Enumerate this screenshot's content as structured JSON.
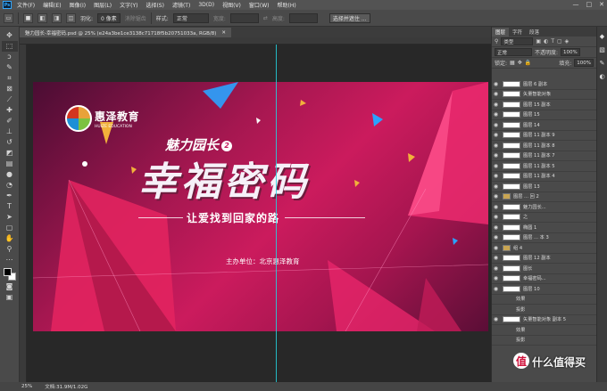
{
  "menubar": {
    "logo": "Ps",
    "items": [
      "文件(F)",
      "编辑(E)",
      "图像(I)",
      "图层(L)",
      "文字(Y)",
      "选择(S)",
      "滤镜(T)",
      "3D(D)",
      "视图(V)",
      "窗口(W)",
      "帮助(H)"
    ],
    "window_controls": [
      "—",
      "□",
      "✕"
    ]
  },
  "options": {
    "feather_label": "羽化:",
    "feather_value": "0 像素",
    "antialias_label": "消除锯齿",
    "style_label": "样式:",
    "style_value": "正常",
    "width_label": "宽度:",
    "height_label": "高度:",
    "mask_button": "选择并遮住 ..."
  },
  "document": {
    "tab_title": "魅力园长-幸福密码.psd @ 25% (e24a3be1ce3138c71718f5b20751033a, RGB/8)",
    "close": "✕"
  },
  "artwork": {
    "logo_cn": "惠泽教育",
    "logo_en": "HUIZE EDUCATION",
    "subtitle": "魅力园长",
    "badge": "2",
    "title": "幸福密码",
    "tagline": "让爱找到回家的路",
    "organizer": "主办单位：北京惠泽教育"
  },
  "panels": {
    "tabs": [
      "图层",
      "字符",
      "段落"
    ],
    "filter_kind": "类型",
    "blend_mode": "正常",
    "opacity_label": "不透明度:",
    "opacity_value": "100%",
    "lock_label": "锁定:",
    "fill_label": "填充:",
    "fill_value": "100%",
    "layers": [
      {
        "name": "图层 6 副本"
      },
      {
        "name": "矢量智能对象"
      },
      {
        "name": "图层 15 副本"
      },
      {
        "name": "图层 15"
      },
      {
        "name": "图层 14"
      },
      {
        "name": "图层 11 副本 9"
      },
      {
        "name": "图层 11 副本 8"
      },
      {
        "name": "图层 11 副本 7"
      },
      {
        "name": "图层 11 副本 5"
      },
      {
        "name": "图层 11 副本 4"
      },
      {
        "name": "图层 13"
      },
      {
        "name": "图层 ... 回 2"
      },
      {
        "name": "魅力园长..."
      },
      {
        "name": "之"
      },
      {
        "name": "椭圆 1"
      },
      {
        "name": "图层 ... 本 3"
      },
      {
        "name": "组 4"
      },
      {
        "name": "图层 12 副本"
      },
      {
        "name": "图长"
      },
      {
        "name": "幸福密码..."
      },
      {
        "name": "图层 10"
      },
      {
        "name": "效果"
      },
      {
        "name": "投影"
      },
      {
        "name": "矢量智能对象 副本 5"
      },
      {
        "name": "效果"
      },
      {
        "name": "投影"
      }
    ]
  },
  "status": {
    "zoom": "25%",
    "doc_size": "文档:31.9M/1.02G"
  },
  "watermark": {
    "badge": "值",
    "text": "什么值得买"
  }
}
